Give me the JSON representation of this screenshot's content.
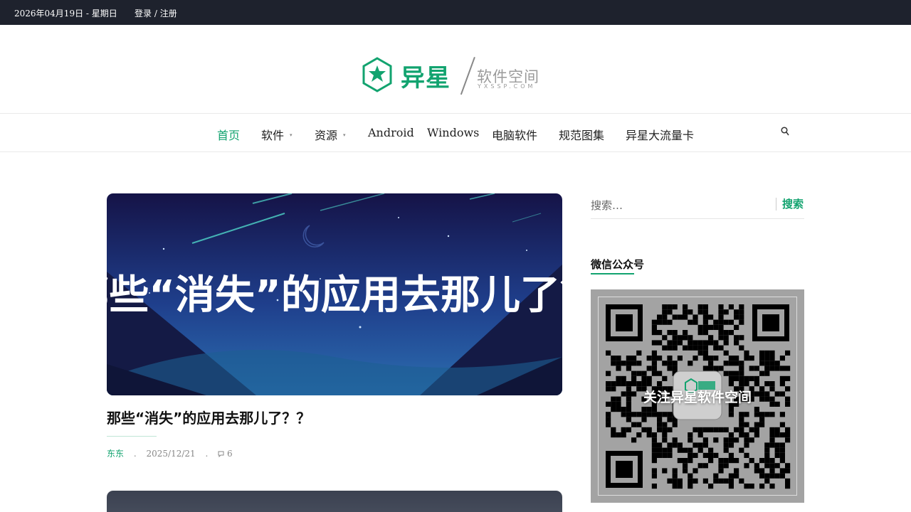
{
  "topbar": {
    "date": "2026年04月19日 - 星期日",
    "login": "登录",
    "separator": " / ",
    "register": "注册"
  },
  "logo": {
    "brand": "异星",
    "subtitle": "软件空间",
    "domain": "YXSSP.COM",
    "color": "#12a36f"
  },
  "nav": {
    "items": [
      {
        "label": "首页",
        "active": true
      },
      {
        "label": "软件",
        "has_dropdown": true
      },
      {
        "label": "资源",
        "has_dropdown": true
      },
      {
        "label": "Android"
      },
      {
        "label": "Windows"
      },
      {
        "label": "电脑软件"
      },
      {
        "label": "规范图集"
      },
      {
        "label": "异星大流量卡"
      }
    ],
    "search_icon": "search-icon"
  },
  "post": {
    "image_text": "那些“消失”的应用去那儿了？",
    "title": "那些“消失”的应用去那儿了？？",
    "author": "东东",
    "date": "2025/12/21",
    "comments": "6",
    "comment_icon": "comment-icon"
  },
  "sidebar": {
    "search": {
      "placeholder": "搜索…",
      "button": "搜索"
    },
    "wechat": {
      "title": "微信公众号",
      "qr_caption": "关注异星软件空间"
    }
  },
  "colors": {
    "accent": "#12a36f",
    "topbar_bg": "#1e222d"
  }
}
